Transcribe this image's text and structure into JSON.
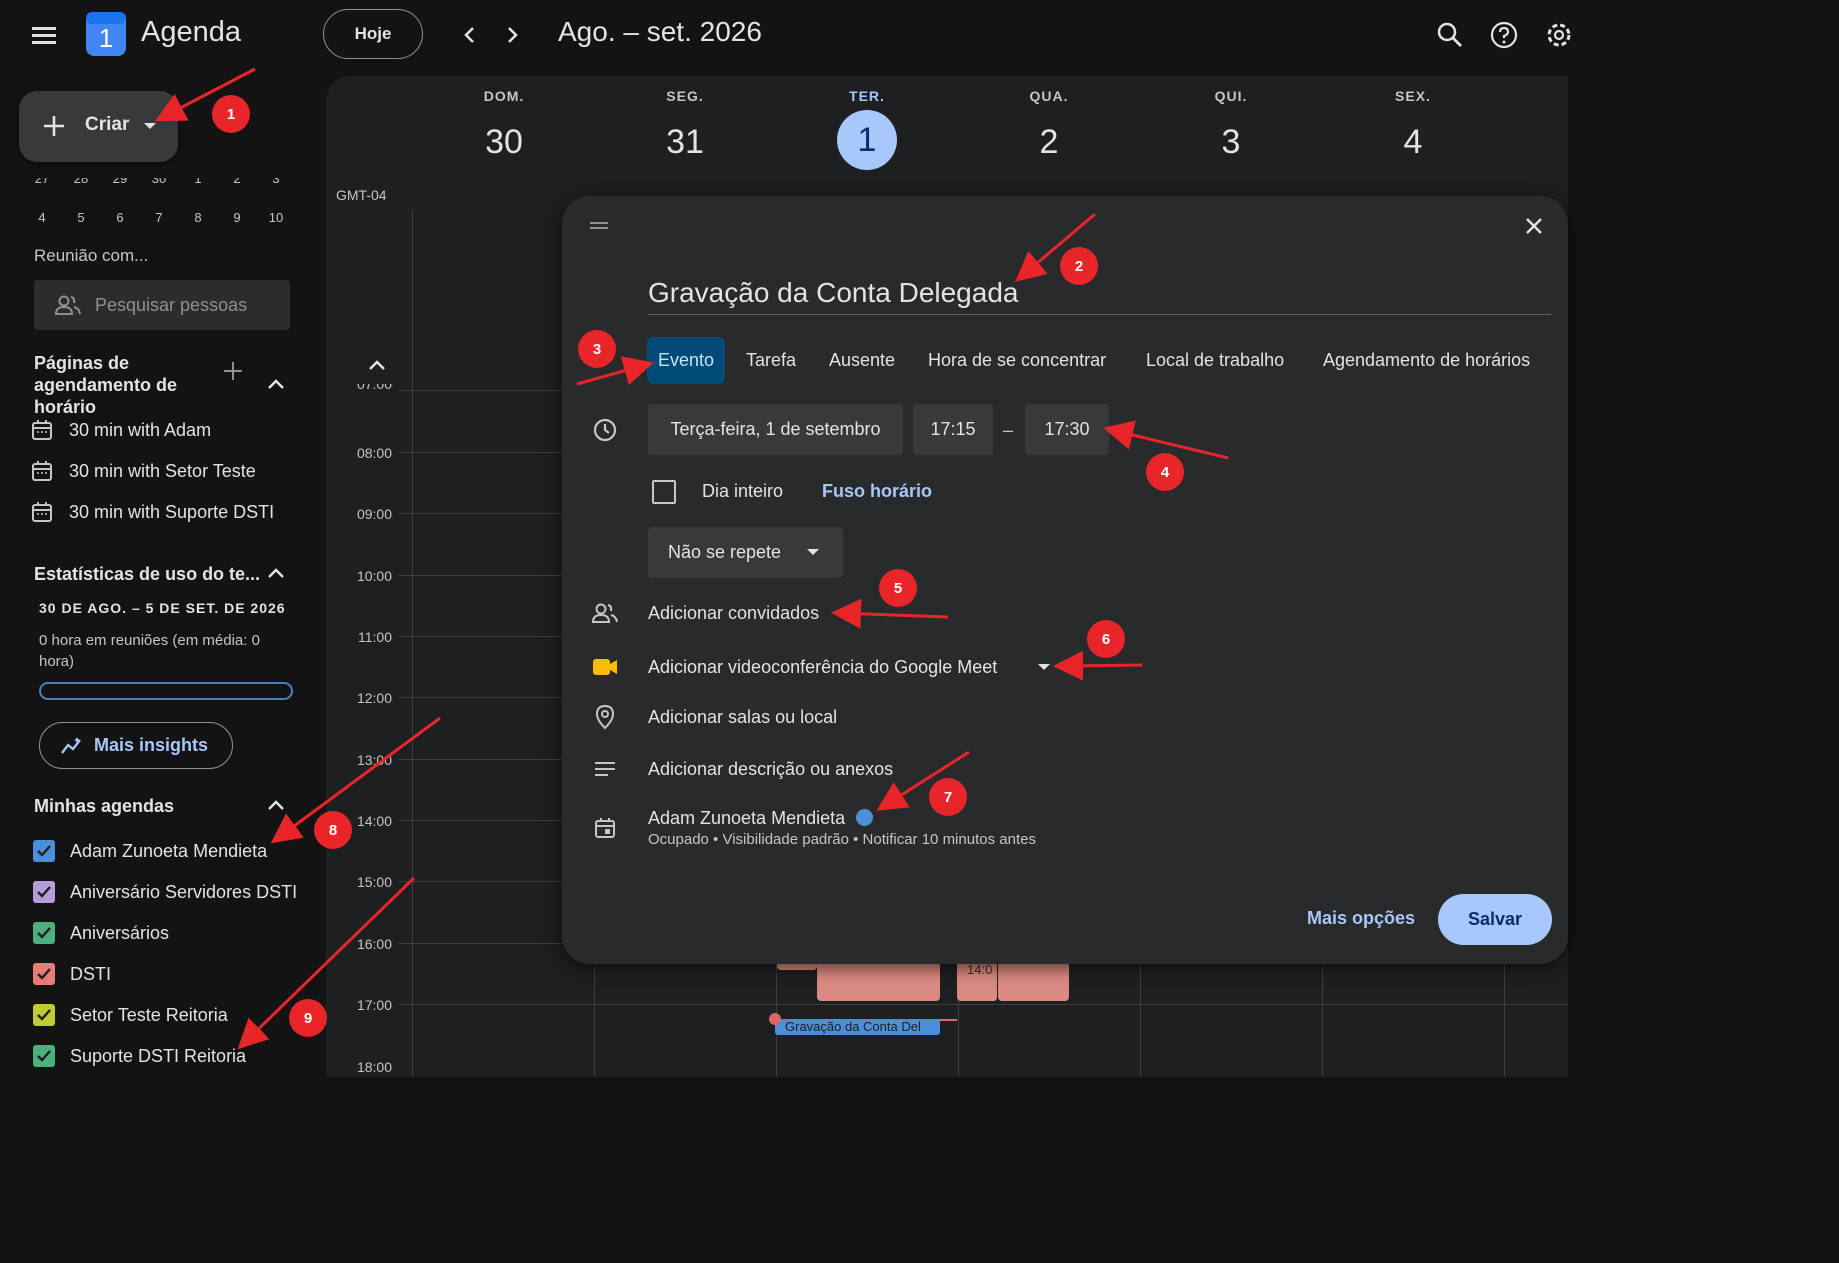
{
  "header": {
    "app_title": "Agenda",
    "logo_number": "1",
    "today_label": "Hoje",
    "range_title": "Ago. – set. 2026",
    "icons": [
      "menu-icon",
      "search-icon",
      "help-icon",
      "settings-icon"
    ]
  },
  "sidebar": {
    "create_label": "Criar",
    "mini_calendar_rows": [
      [
        "27",
        "28",
        "29",
        "30",
        "1",
        "2",
        "3"
      ],
      [
        "4",
        "5",
        "6",
        "7",
        "8",
        "9",
        "10"
      ]
    ],
    "meet_with": "Reunião com...",
    "people_search_placeholder": "Pesquisar pessoas",
    "booking_title": "Páginas de agendamento de horário",
    "booking_items": [
      {
        "label": "30 min with Adam"
      },
      {
        "label": "30 min with Setor Teste"
      },
      {
        "label": "30 min with Suporte DSTI"
      }
    ],
    "stats_title": "Estatísticas de uso do te...",
    "stats_date": "30 DE AGO. – 5 DE SET. DE 2026",
    "stats_text": "0 hora em reuniões (em média: 0 hora)",
    "insights_label": "Mais insights",
    "my_calendars_title": "Minhas agendas",
    "calendars": [
      {
        "label": "Adam Zunoeta Mendieta",
        "color": "#4a8fd8"
      },
      {
        "label": "Aniversário Servidores DSTI",
        "color": "#b39ddb"
      },
      {
        "label": "Aniversários",
        "color": "#4caf7d"
      },
      {
        "label": "DSTI",
        "color": "#e67c73"
      },
      {
        "label": "Setor Teste Reitoria",
        "color": "#c0ca33"
      },
      {
        "label": "Suporte DSTI Reitoria",
        "color": "#4caf7d"
      }
    ]
  },
  "week": {
    "timezone": "GMT-04",
    "days": [
      {
        "name": "DOM.",
        "num": "30"
      },
      {
        "name": "SEG.",
        "num": "31"
      },
      {
        "name": "TER.",
        "num": "1",
        "today": true
      },
      {
        "name": "QUA.",
        "num": "2"
      },
      {
        "name": "QUI.",
        "num": "3"
      },
      {
        "name": "SEX.",
        "num": "4"
      }
    ],
    "hours": [
      "07:00",
      "08:00",
      "09:00",
      "10:00",
      "11:00",
      "12:00",
      "13:00",
      "14:00",
      "15:00",
      "16:00",
      "17:00",
      "18:00"
    ],
    "partial_event_time": "14:0",
    "draft_event_label": "Gravação da Conta Del"
  },
  "dialog": {
    "title": "Gravação da Conta Delegada",
    "tabs": [
      "Evento",
      "Tarefa",
      "Ausente",
      "Hora de se concentrar",
      "Local de trabalho",
      "Agendamento de horários"
    ],
    "active_tab": "Evento",
    "date": "Terça-feira, 1 de setembro",
    "start_time": "17:15",
    "separator": "–",
    "end_time": "17:30",
    "all_day_label": "Dia inteiro",
    "timezone_link": "Fuso horário",
    "repeat_label": "Não se repete",
    "add_guests": "Adicionar convidados",
    "add_meet": "Adicionar videoconferência do Google Meet",
    "add_location": "Adicionar salas ou local",
    "add_description": "Adicionar descrição ou anexos",
    "owner_name": "Adam Zunoeta Mendieta",
    "owner_details": "Ocupado • Visibilidade padrão • Notificar 10 minutos antes",
    "more_options": "Mais opções",
    "save": "Salvar"
  },
  "annotations": [
    "1",
    "2",
    "3",
    "4",
    "5",
    "6",
    "7",
    "8",
    "9"
  ],
  "colors": {
    "background": "#131314",
    "surface": "#1e1f20",
    "dialog": "#282a2c",
    "accent": "#a8c7fa",
    "annotation_red": "#e8262a"
  }
}
